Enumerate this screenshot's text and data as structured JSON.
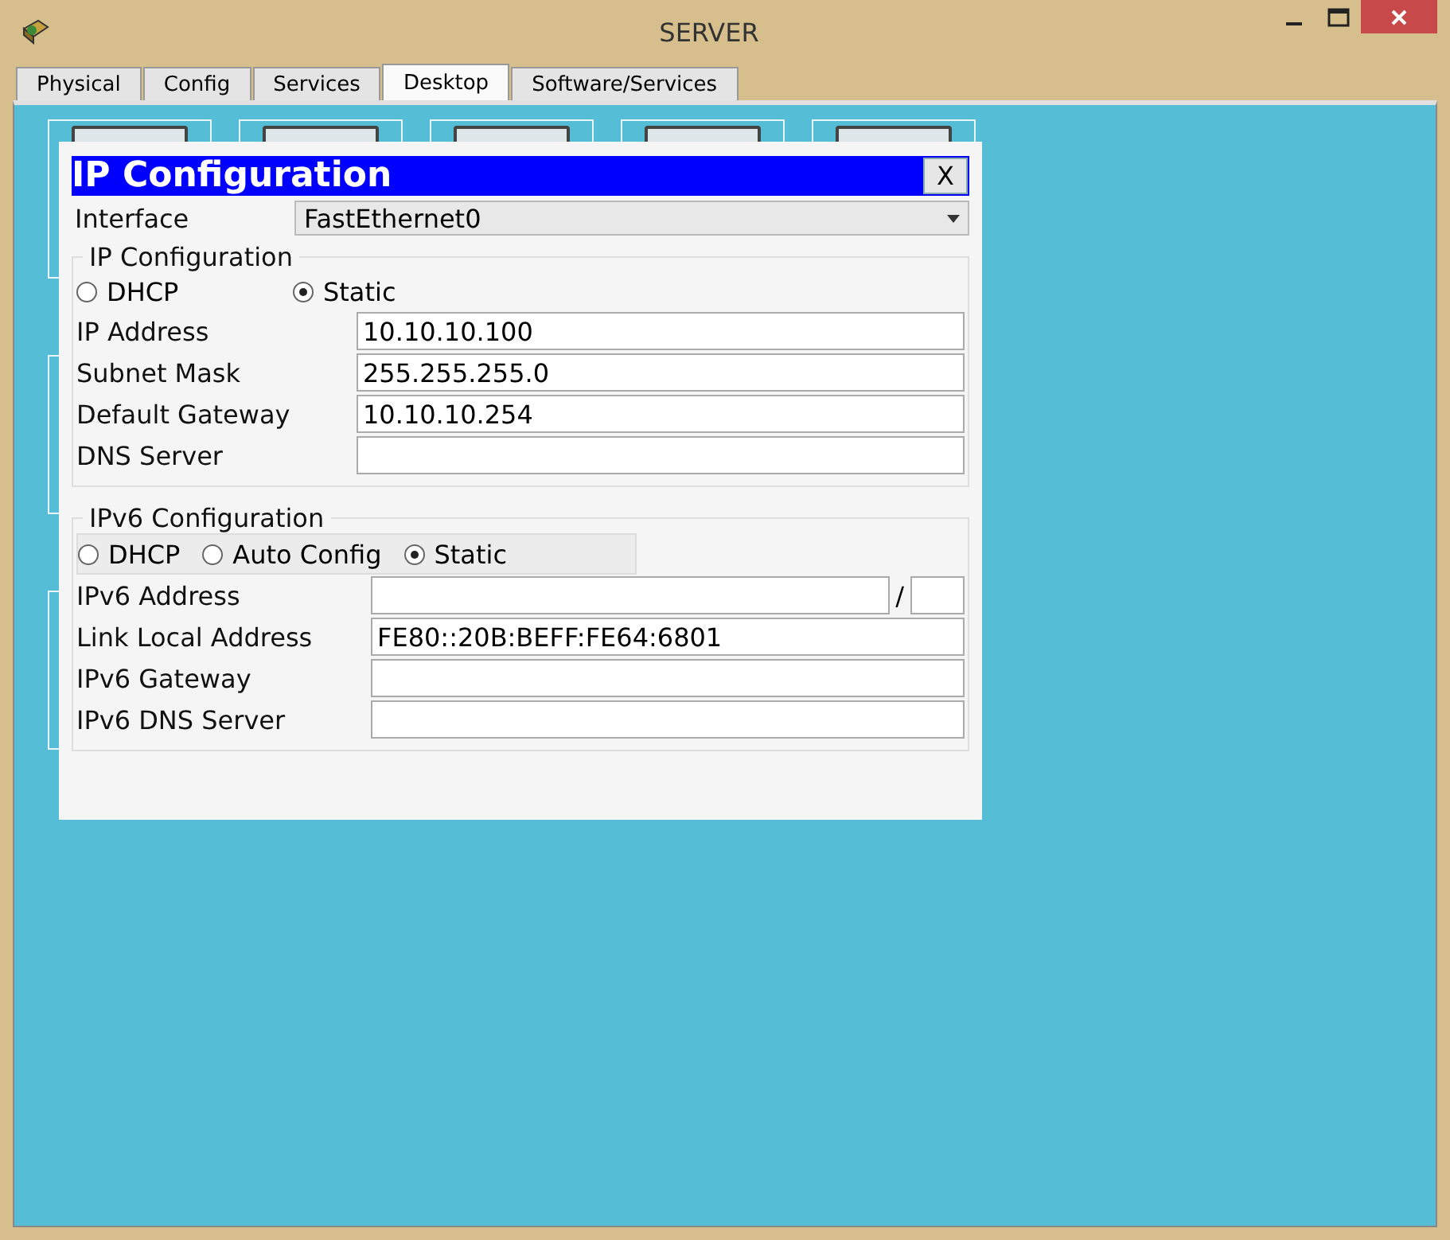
{
  "window": {
    "title": "SERVER"
  },
  "tabs": [
    {
      "label": "Physical",
      "selected": false
    },
    {
      "label": "Config",
      "selected": false
    },
    {
      "label": "Services",
      "selected": false
    },
    {
      "label": "Desktop",
      "selected": true
    },
    {
      "label": "Software/Services",
      "selected": false
    }
  ],
  "dialog": {
    "title": "IP Configuration",
    "close": "X",
    "interface": {
      "label": "Interface",
      "value": "FastEthernet0"
    },
    "ipv4": {
      "legend": "IP Configuration",
      "modes": [
        {
          "label": "DHCP",
          "selected": false
        },
        {
          "label": "Static",
          "selected": true
        }
      ],
      "fields": [
        {
          "kind": "plain",
          "label": "IP Address",
          "value": "10.10.10.100"
        },
        {
          "kind": "plain",
          "label": "Subnet Mask",
          "value": "255.255.255.0"
        },
        {
          "kind": "plain",
          "label": "Default Gateway",
          "value": "10.10.10.254"
        },
        {
          "kind": "plain",
          "label": "DNS Server"
        }
      ]
    },
    "ipv6": {
      "legend": "IPv6 Configuration",
      "modes": [
        {
          "label": "DHCP",
          "selected": false
        },
        {
          "label": "Auto Config",
          "selected": false
        },
        {
          "label": "Static",
          "selected": true
        }
      ],
      "fields": [
        {
          "kind": "prefix",
          "label": "IPv6 Address",
          "separator": "/"
        },
        {
          "kind": "plain",
          "label": "Link Local Address",
          "value": "FE80::20B:BEFF:FE64:6801"
        },
        {
          "kind": "plain",
          "label": "IPv6 Gateway"
        },
        {
          "kind": "plain",
          "label": "IPv6 DNS Server"
        }
      ]
    }
  }
}
